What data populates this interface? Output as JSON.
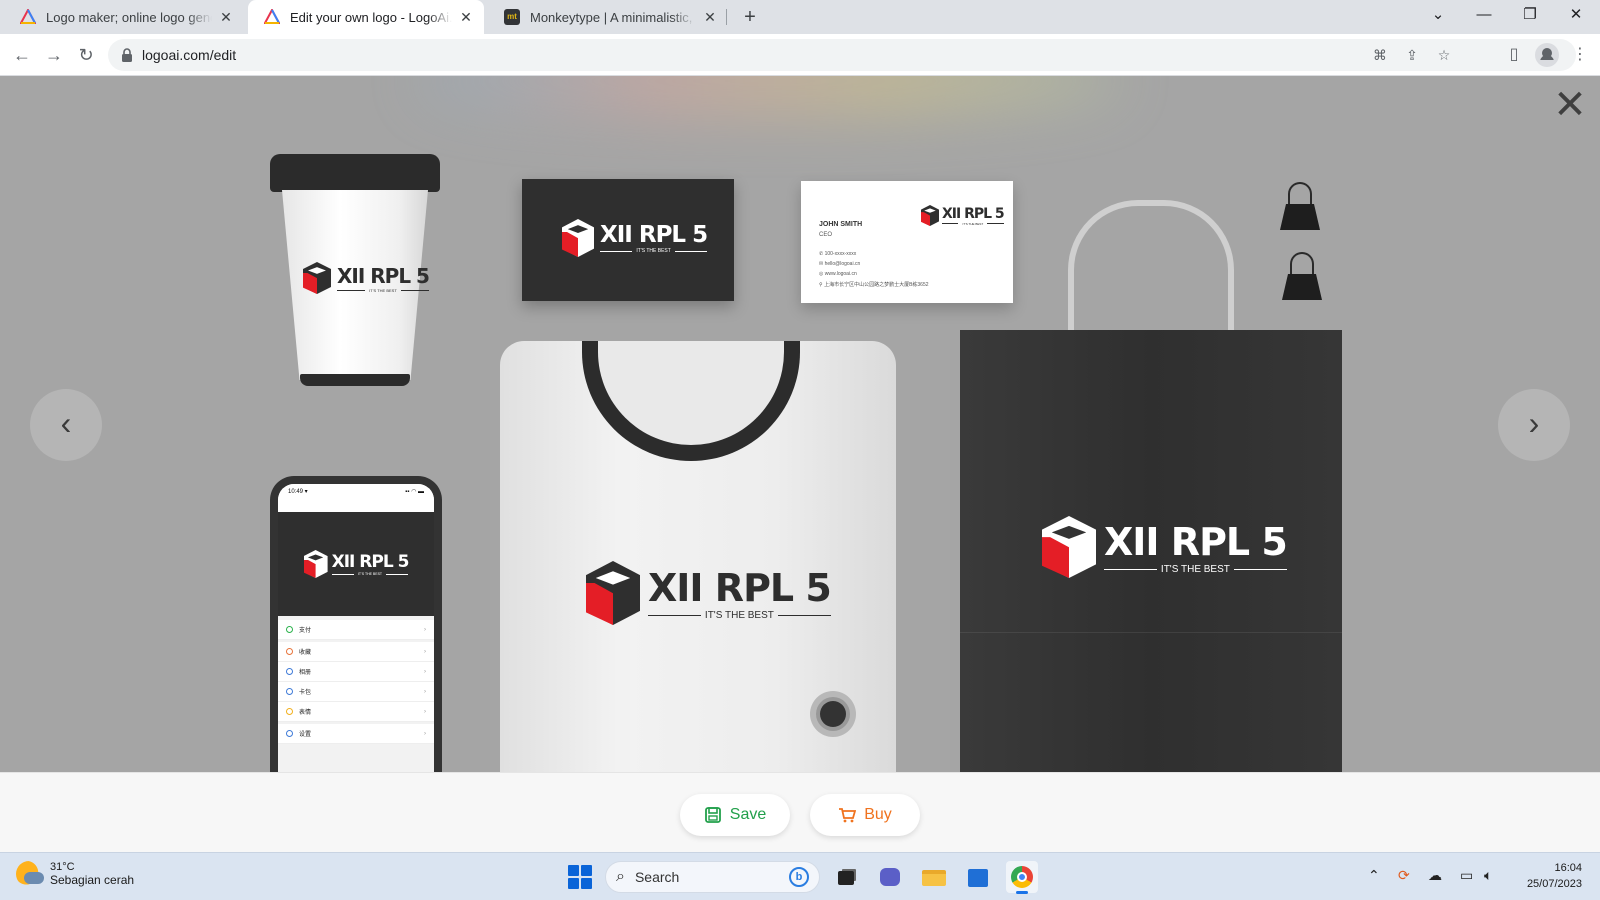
{
  "browser": {
    "tabs": [
      {
        "title": "Logo maker; online logo generator",
        "active": false
      },
      {
        "title": "Edit your own logo - LogoAi.com",
        "active": true
      },
      {
        "title": "Monkeytype | A minimalistic, customizable typing test",
        "active": false
      }
    ],
    "url": "logoai.com/edit"
  },
  "logo": {
    "name": "XII RPL 5",
    "tagline": "IT'S THE BEST"
  },
  "business_card": {
    "name": "JOHN SMITH",
    "role": "CEO",
    "phone": "100-xxxx-xxxx",
    "email": "hello@logoai.cn",
    "web": "www.logoai.cn",
    "address": "上海市长宁区中山公园路之梦鹏士大厦B栋3652"
  },
  "phone_mock": {
    "time": "10:49",
    "menu": [
      "支付",
      "收藏",
      "相册",
      "卡包",
      "表情",
      "设置"
    ],
    "menu_colors": [
      "#2bb24c",
      "#e8743b",
      "#3f7bd8",
      "#3f7bd8",
      "#f2b01e",
      "#3f7bd8"
    ]
  },
  "footer": {
    "save_label": "Save",
    "buy_label": "Buy",
    "save_color": "#22a04b",
    "buy_color": "#f0731f"
  },
  "taskbar": {
    "temperature": "31°C",
    "weather": "Sebagian cerah",
    "search_label": "Search",
    "time": "16:04",
    "date": "25/07/2023"
  }
}
